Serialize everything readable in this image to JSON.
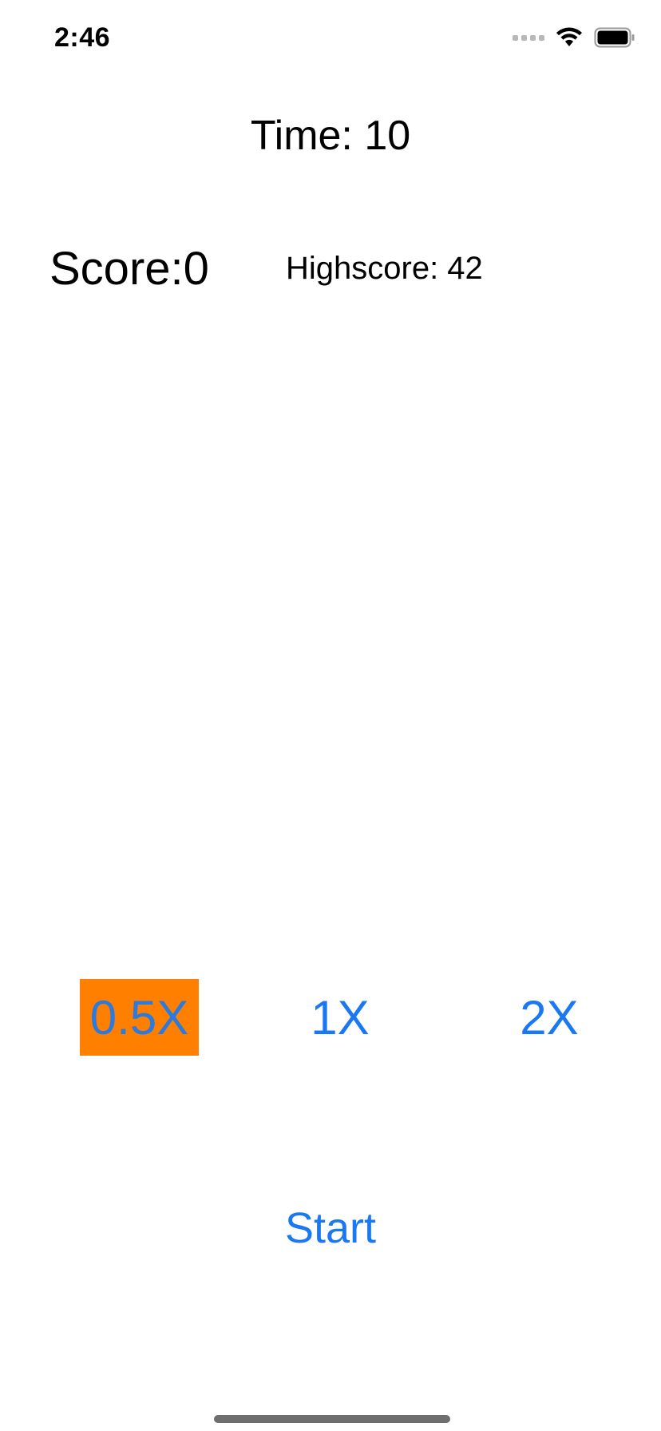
{
  "status_bar": {
    "time": "2:46",
    "icons": [
      "signal-icon",
      "wifi-icon",
      "battery-icon"
    ]
  },
  "game": {
    "time_label": "Time: 10",
    "score_label": "Score:0",
    "highscore_label": "Highscore: 42"
  },
  "speed_options": [
    {
      "label": "0.5X",
      "selected": true
    },
    {
      "label": "1X",
      "selected": false
    },
    {
      "label": "2X",
      "selected": false
    }
  ],
  "start_label": "Start",
  "colors": {
    "accent": "#1a78f2",
    "selected_background": "#ff7f00",
    "text": "#000000",
    "background": "#ffffff"
  }
}
